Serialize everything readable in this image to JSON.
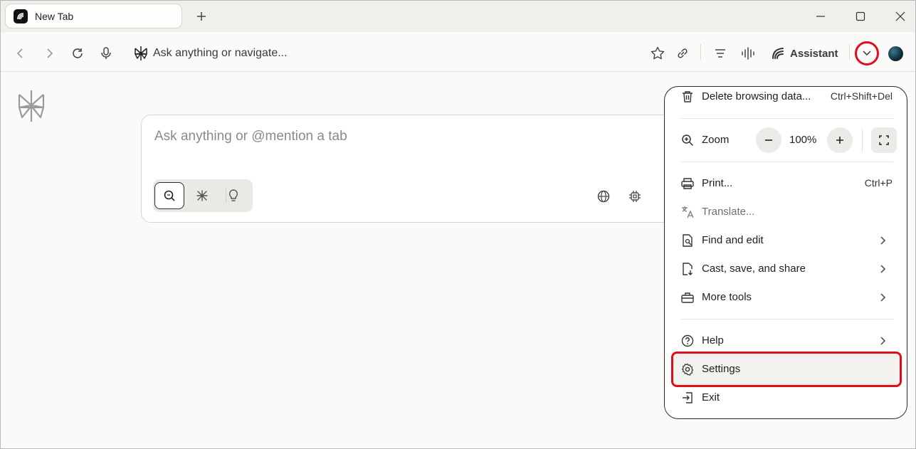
{
  "tab": {
    "title": "New Tab"
  },
  "toolbar": {
    "omnibox_placeholder": "Ask anything or navigate...",
    "assistant_label": "Assistant"
  },
  "search": {
    "placeholder": "Ask anything or @mention a tab"
  },
  "menu": {
    "items": [
      {
        "label": "Delete browsing data...",
        "shortcut": "Ctrl+Shift+Del",
        "icon": "trash-icon"
      },
      {
        "label": "Zoom",
        "icon": "zoom-icon",
        "zoom_value": "100%"
      },
      {
        "label": "Print...",
        "shortcut": "Ctrl+P",
        "icon": "printer-icon"
      },
      {
        "label": "Translate...",
        "icon": "translate-icon",
        "disabled": true
      },
      {
        "label": "Find and edit",
        "icon": "find-icon",
        "submenu": true
      },
      {
        "label": "Cast, save, and share",
        "icon": "cast-icon",
        "submenu": true
      },
      {
        "label": "More tools",
        "icon": "toolbox-icon",
        "submenu": true
      },
      {
        "label": "Help",
        "icon": "help-icon",
        "submenu": true
      },
      {
        "label": "Settings",
        "icon": "gear-icon",
        "highlighted": true
      },
      {
        "label": "Exit",
        "icon": "exit-icon"
      }
    ]
  },
  "colors": {
    "highlight": "#e00e1a",
    "background": "#fbfaf8"
  }
}
